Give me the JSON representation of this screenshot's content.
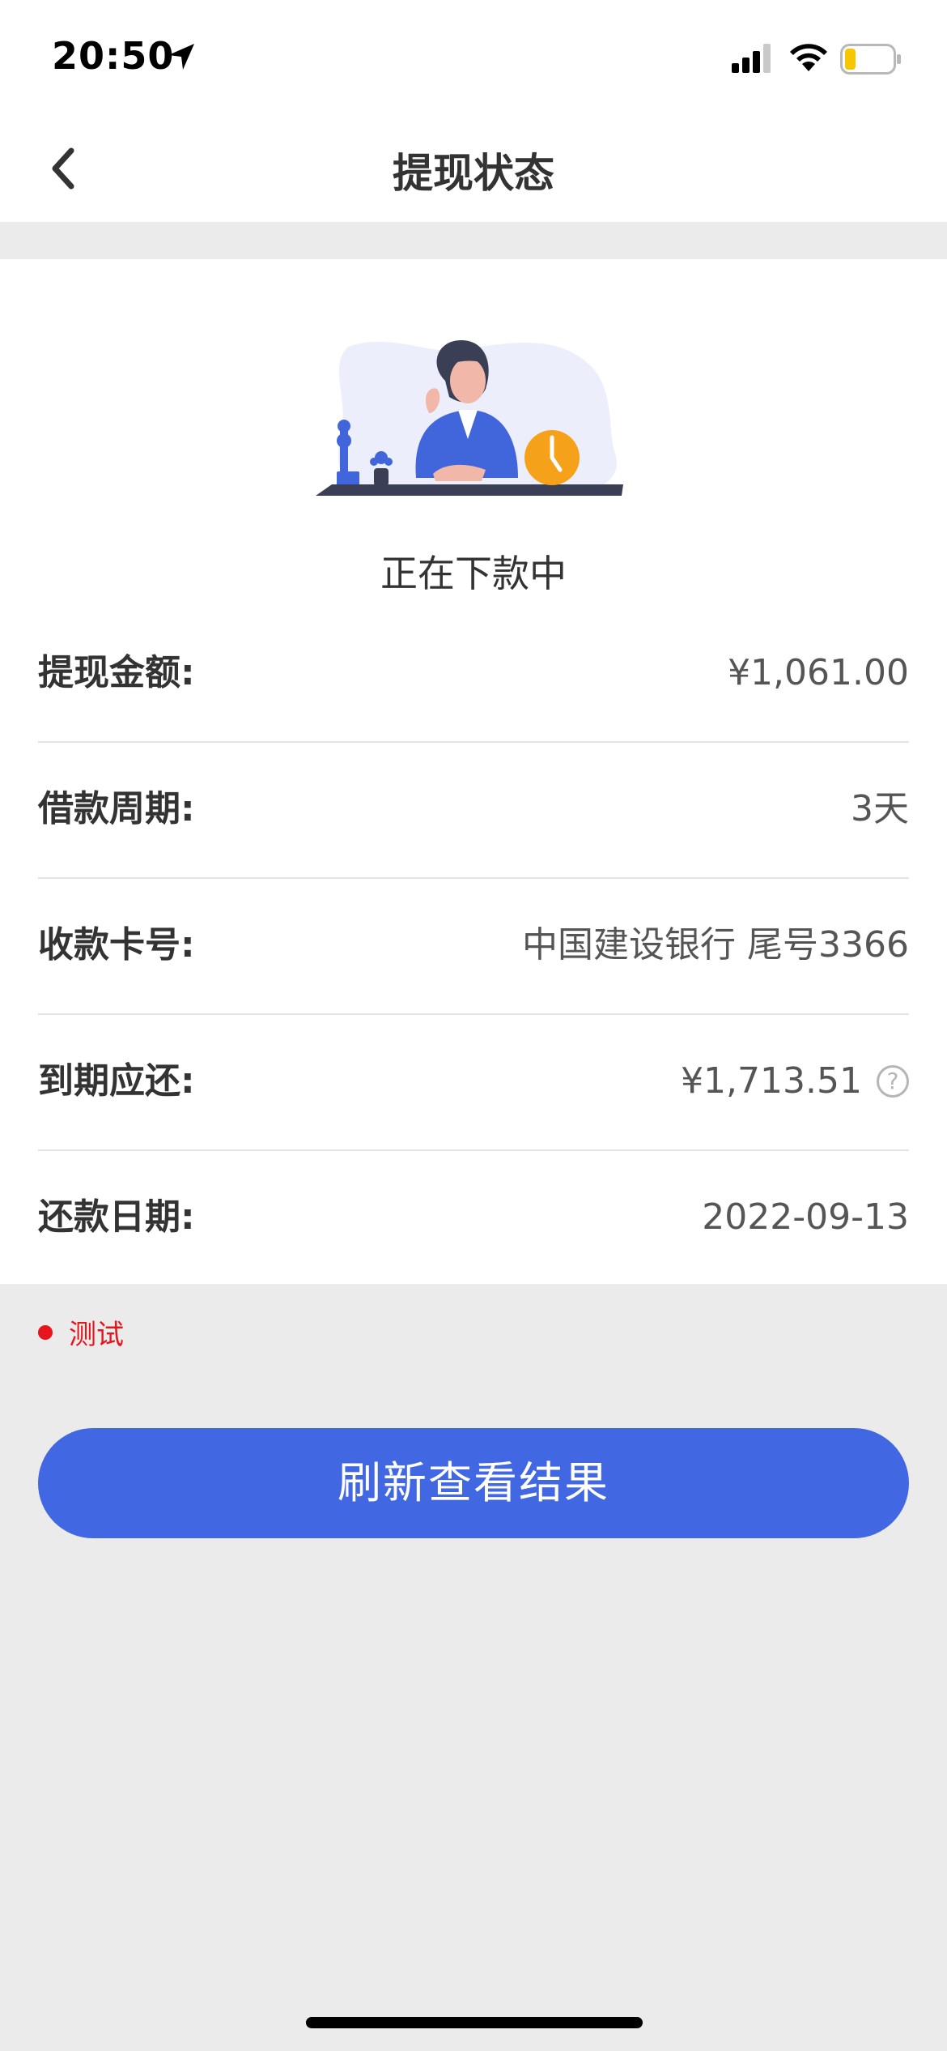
{
  "status_bar": {
    "time": "20:50",
    "icons": [
      "location-arrow-icon",
      "signal-icon",
      "wifi-icon",
      "battery-icon"
    ]
  },
  "nav": {
    "title": "提现状态",
    "back_icon": "chevron-left-icon"
  },
  "status": {
    "illustration": "woman-waiting-clock-illustration",
    "text": "正在下款中"
  },
  "details": [
    {
      "label": "提现金额:",
      "value": "¥1,061.00"
    },
    {
      "label": "借款周期:",
      "value": "3天"
    },
    {
      "label": "收款卡号:",
      "value": "中国建设银行 尾号3366"
    },
    {
      "label": "到期应还:",
      "value": "¥1,713.51",
      "help_icon": "?"
    },
    {
      "label": "还款日期:",
      "value": "2022-09-13"
    }
  ],
  "note": {
    "text": "测试",
    "color": "#e8141d"
  },
  "refresh_button": {
    "label": "刷新查看结果",
    "color": "#4267e2"
  }
}
